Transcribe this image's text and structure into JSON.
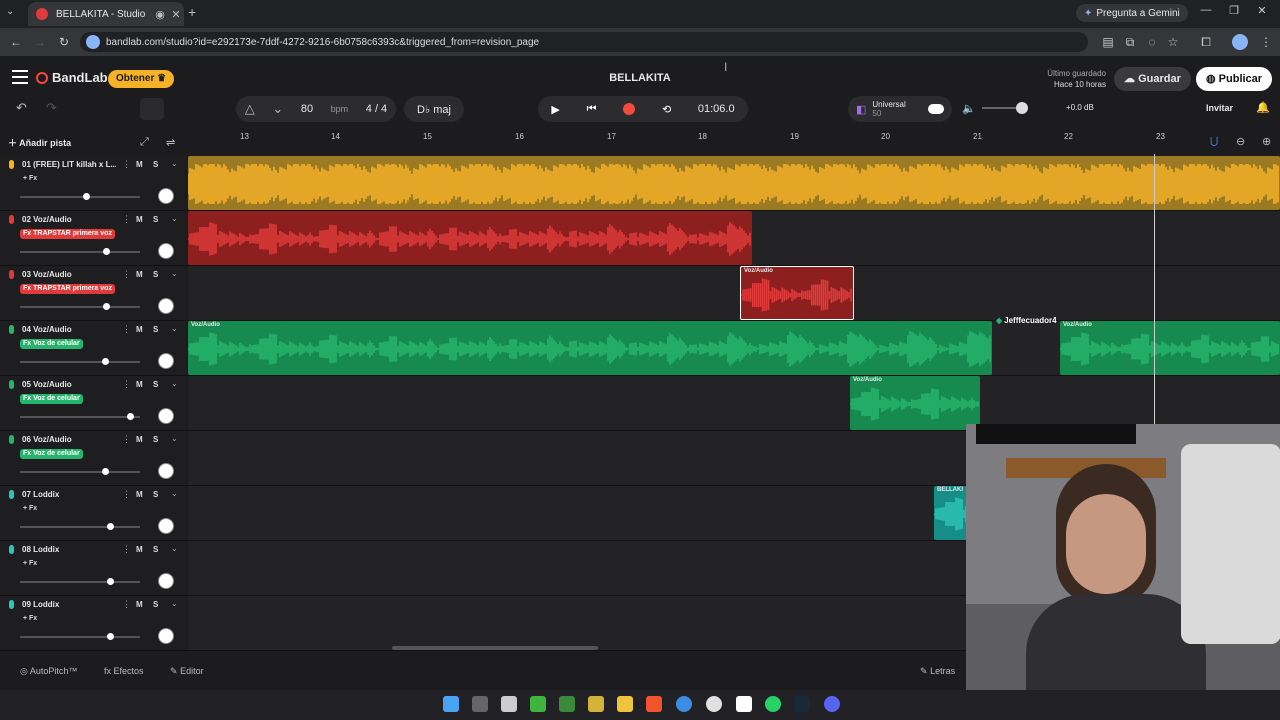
{
  "browser": {
    "tab_title": "BELLAKITA - Studio",
    "new_tab": "+",
    "gemini_label": "Pregunta a Gemini",
    "url": "bandlab.com/studio?id=e292173e-7ddf-4272-9216-6b0758c6393c&triggered_from=revision_page"
  },
  "header": {
    "logo": "BandLab",
    "obtener": "Obtener",
    "project_title": "BELLAKITA",
    "last_saved_label": "Último guardado",
    "last_saved_value": "Hace 10 horas",
    "save": "Guardar",
    "publish": "Publicar"
  },
  "toolbar": {
    "bpm": "80",
    "bpm_unit": "bpm",
    "time_sig": "4 / 4",
    "key": "D♭ maj",
    "time": "01:06.0",
    "universal": "Universal",
    "universal_sub": "50",
    "volume_db": "+0.0 dB",
    "invite": "Invitar"
  },
  "add_track": "Añadir pista",
  "ruler": [
    "13",
    "14",
    "15",
    "16",
    "17",
    "18",
    "19",
    "20",
    "21",
    "22",
    "23"
  ],
  "tracks": [
    {
      "name": "01 (FREE) LIT killah x L...",
      "fx": "+ Fx",
      "color": "#f5b227",
      "fx_style": "plain",
      "vol": 0.55
    },
    {
      "name": "02 Voz/Audio",
      "fx": "Fx TRAPSTAR primera voz",
      "color": "#e03a3a",
      "fx_style": "red",
      "vol": 0.72
    },
    {
      "name": "03 Voz/Audio",
      "fx": "Fx TRAPSTAR primera voz",
      "color": "#e03a3a",
      "fx_style": "red",
      "vol": 0.72
    },
    {
      "name": "04 Voz/Audio",
      "fx": "Fx Voz de celular",
      "color": "#25b46b",
      "fx_style": "green",
      "vol": 0.71
    },
    {
      "name": "05 Voz/Audio",
      "fx": "Fx Voz de celular",
      "color": "#25b46b",
      "fx_style": "green",
      "vol": 0.92
    },
    {
      "name": "06 Voz/Audio",
      "fx": "Fx Voz de celular",
      "color": "#25b46b",
      "fx_style": "green",
      "vol": 0.71
    },
    {
      "name": "07 Loddix",
      "fx": "+ Fx",
      "color": "#2ec4b6",
      "fx_style": "plain",
      "vol": 0.75
    },
    {
      "name": "08 Loddix",
      "fx": "+ Fx",
      "color": "#2ec4b6",
      "fx_style": "plain",
      "vol": 0.75
    },
    {
      "name": "09 Loddix",
      "fx": "+ Fx",
      "color": "#2ec4b6",
      "fx_style": "plain",
      "vol": 0.75
    }
  ],
  "track_controls": {
    "mute": "M",
    "solo": "S"
  },
  "clips": {
    "voz_audio": "Voz/Audio",
    "bellakita": "BELLAKI"
  },
  "collaborator": "Jefffecuador4",
  "bottom": {
    "autopitch": "AutoPitch™",
    "effects": "Efectos",
    "editor": "Editor",
    "lyrics": "Letras"
  }
}
